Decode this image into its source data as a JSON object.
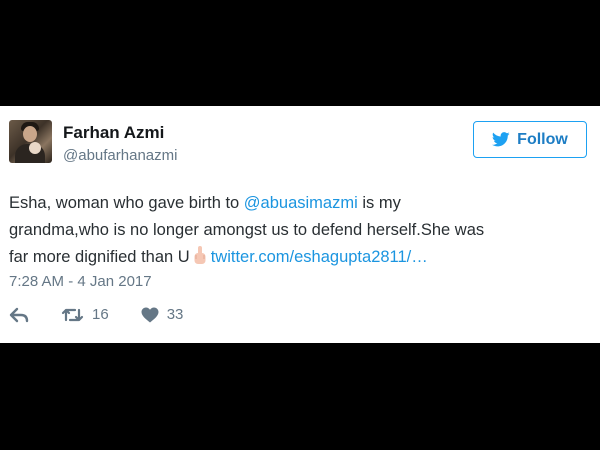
{
  "tweet": {
    "author_name": "Farhan Azmi",
    "handle": "@abufarhanazmi",
    "follow_label": "Follow",
    "text": {
      "line1_prefix": "Esha, woman who gave birth to ",
      "mention": "@abuasimazmi",
      "line1_suffix": " is my",
      "line2": "grandma,who is no longer amongst us to defend herself.She was",
      "line3_prefix": "far more dignified than U",
      "link": "twitter.com/eshagupta2811/…"
    },
    "timestamp": "7:28 AM - 4 Jan 2017",
    "retweet_count": "16",
    "like_count": "33"
  },
  "icons": {
    "follow": "twitter-bird-icon",
    "emoji": "middle-finger-emoji",
    "reply": "reply-arrow-icon",
    "retweet": "retweet-icon",
    "like": "heart-icon"
  },
  "colors": {
    "link": "#1b95e0",
    "follow_border": "#1da1f2",
    "secondary_text": "#657786",
    "primary_text": "#292f33"
  }
}
